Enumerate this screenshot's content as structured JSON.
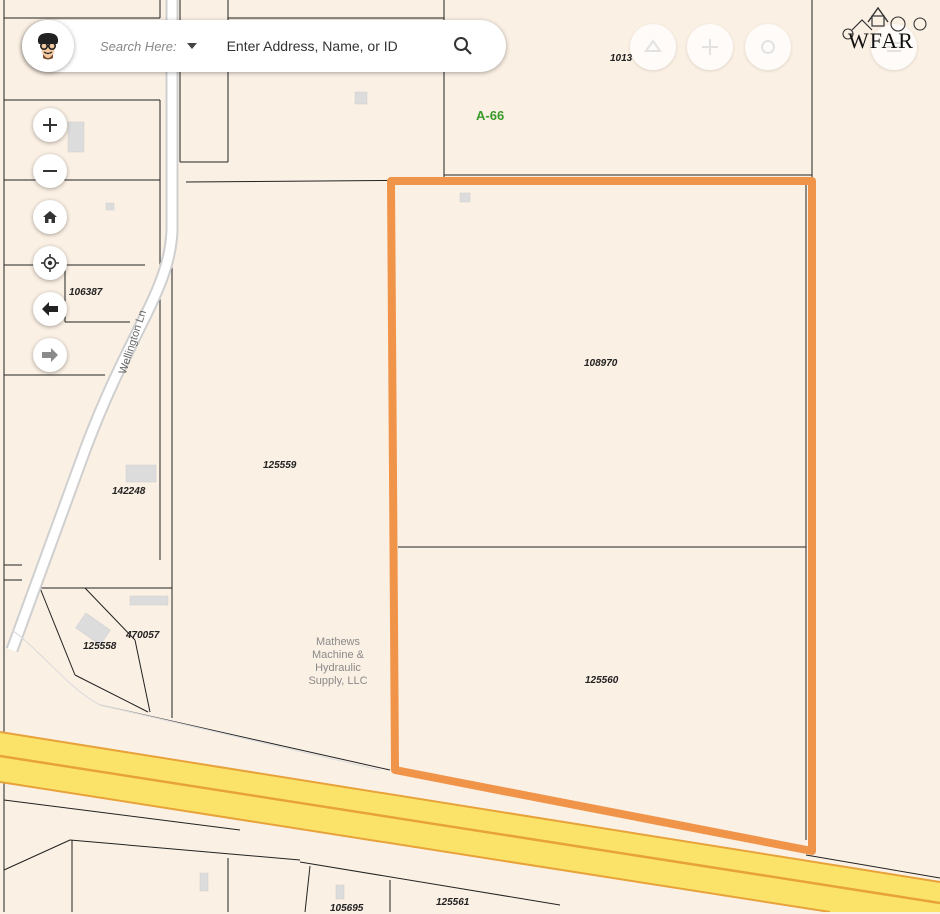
{
  "search": {
    "scope_label": "Search Here:",
    "placeholder": "Enter Address, Name, or ID"
  },
  "map_controls": {
    "zoom_in": "zoom-in",
    "zoom_out": "zoom-out",
    "home": "home",
    "locate": "locate",
    "back": "back",
    "forward": "forward"
  },
  "map": {
    "abstract_label": "A-66",
    "street_label": "Wellington Ln",
    "business_label_lines": [
      "Mathews",
      "Machine &",
      "Hydraulic",
      "Supply, LLC"
    ],
    "parcels": {
      "p1": "1013",
      "p2": "106387",
      "p3": "108970",
      "p4": "125559",
      "p5": "142248",
      "p6": "470057",
      "p7": "125558",
      "p8": "125560",
      "p9": "105695",
      "p10": "125561"
    },
    "colors": {
      "background": "#fbf0e4",
      "highway_fill": "#fbe36a",
      "highway_edge": "#e8a23a",
      "highlight": "#f0944a",
      "parcel_line": "#222222",
      "abstract_label": "#3a9a2a"
    }
  },
  "logo": {
    "text": "WFAR"
  }
}
